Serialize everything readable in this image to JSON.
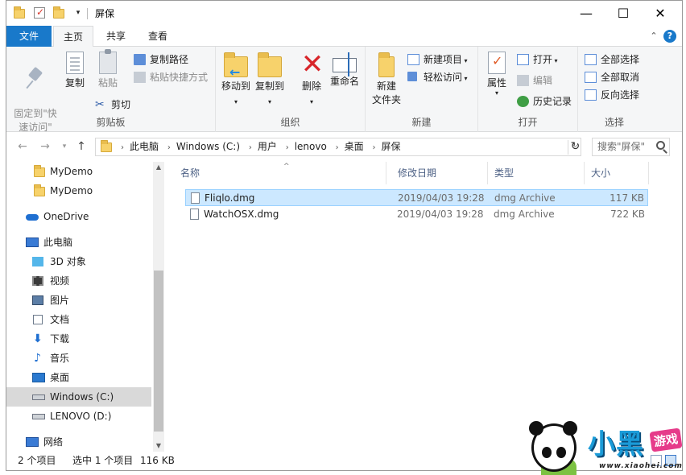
{
  "window": {
    "title": "屏保",
    "controls": {
      "minimize": "—",
      "maximize": "☐",
      "close": "✕"
    }
  },
  "ribbon_tabs": [
    "文件",
    "主页",
    "共享",
    "查看"
  ],
  "ribbon": {
    "clipboard": {
      "label": "剪贴板",
      "pin": "固定到\"快\n速访问\"",
      "copy": "复制",
      "paste": "粘贴",
      "copy_path": "复制路径",
      "paste_shortcut": "粘贴快捷方式",
      "cut": "剪切"
    },
    "organize": {
      "label": "组织",
      "move_to": "移动到",
      "copy_to": "复制到",
      "delete": "删除",
      "rename": "重命名"
    },
    "new": {
      "label": "新建",
      "new_folder_line1": "新建",
      "new_folder_line2": "文件夹",
      "new_item": "新建项目",
      "easy_access": "轻松访问"
    },
    "open": {
      "label": "打开",
      "properties": "属性",
      "open": "打开",
      "edit": "编辑",
      "history": "历史记录"
    },
    "select": {
      "label": "选择",
      "select_all": "全部选择",
      "select_none": "全部取消",
      "invert": "反向选择"
    }
  },
  "address": {
    "crumbs": [
      "此电脑",
      "Windows (C:)",
      "用户",
      "lenovo",
      "桌面",
      "屏保"
    ],
    "search_placeholder": "搜索\"屏保\""
  },
  "nav": [
    {
      "label": "MyDemo",
      "icon": "folder-icon"
    },
    {
      "label": "MyDemo",
      "icon": "folder-icon"
    },
    {
      "label": "OneDrive",
      "icon": "cloud-icon"
    },
    {
      "label": "此电脑",
      "icon": "computer-icon"
    },
    {
      "label": "3D 对象",
      "icon": "3d-objects-icon"
    },
    {
      "label": "视频",
      "icon": "video-icon"
    },
    {
      "label": "图片",
      "icon": "pictures-icon"
    },
    {
      "label": "文档",
      "icon": "documents-icon"
    },
    {
      "label": "下载",
      "icon": "download-icon"
    },
    {
      "label": "音乐",
      "icon": "music-icon"
    },
    {
      "label": "桌面",
      "icon": "desktop-icon"
    },
    {
      "label": "Windows (C:)",
      "icon": "drive-icon"
    },
    {
      "label": "LENOVO (D:)",
      "icon": "drive-icon"
    },
    {
      "label": "网络",
      "icon": "network-icon"
    }
  ],
  "columns": {
    "name": "名称",
    "modified": "修改日期",
    "type": "类型",
    "size": "大小"
  },
  "files": [
    {
      "name": "Fliqlo.dmg",
      "modified": "2019/04/03 19:28",
      "type": "dmg Archive",
      "size": "117 KB",
      "selected": true
    },
    {
      "name": "WatchOSX.dmg",
      "modified": "2019/04/03 19:28",
      "type": "dmg Archive",
      "size": "722 KB",
      "selected": false
    }
  ],
  "status": {
    "count": "2 个项目",
    "selected": "选中 1 个项目",
    "size": "116 KB"
  },
  "watermark": {
    "text": "小黑",
    "badge": "游戏",
    "url": "www.xiaohei.com"
  },
  "colors": {
    "accent": "#1979ca",
    "selection": "#cce8ff"
  }
}
